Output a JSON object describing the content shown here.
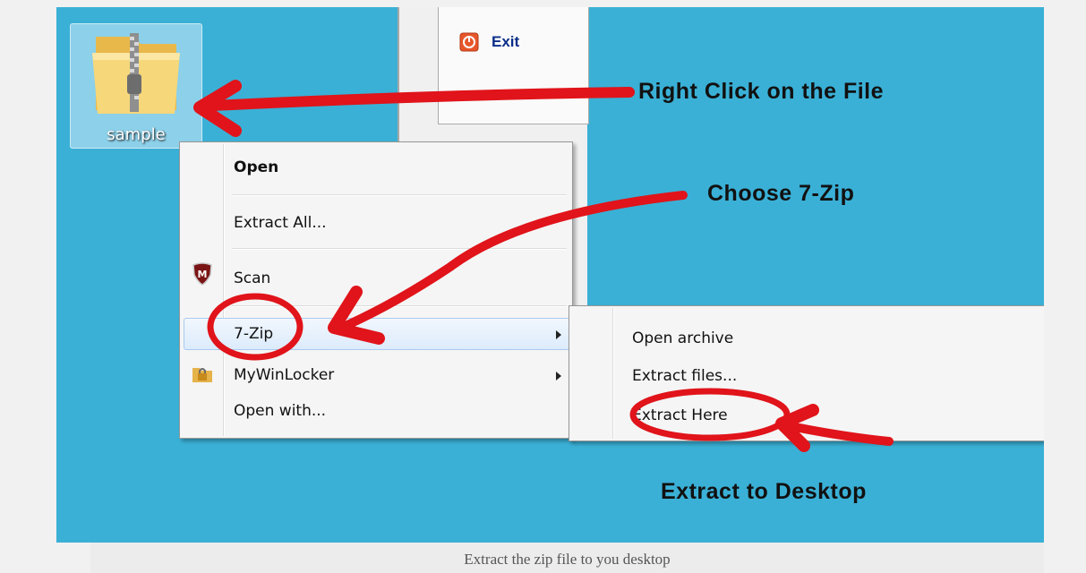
{
  "desktop": {
    "icon_label": "sample",
    "icon_name": "zip-folder-icon"
  },
  "start_menu": {
    "exit_label": "Exit"
  },
  "context_menu": {
    "items": [
      {
        "label": "Open",
        "bold": true
      },
      {
        "label": "Extract All..."
      },
      {
        "label": "Scan",
        "icon": "mcafee-shield-icon"
      },
      {
        "label": "7-Zip",
        "submenu": true,
        "highlighted": true
      },
      {
        "label": "MyWinLocker",
        "icon": "lock-folder-icon",
        "submenu": true
      },
      {
        "label": "Open with..."
      }
    ]
  },
  "submenu": {
    "items": [
      {
        "label": "Open archive"
      },
      {
        "label": "Extract files..."
      },
      {
        "label": "Extract Here"
      }
    ]
  },
  "annotations": {
    "step1": "Right Click on the File",
    "step2": "Choose 7-Zip",
    "step3": "Extract to Desktop"
  },
  "caption": "Extract the zip file to you desktop",
  "colors": {
    "desktop_bg": "#3ab0d6",
    "annotation_red": "#e0141a",
    "highlight": "#dcebfc"
  }
}
